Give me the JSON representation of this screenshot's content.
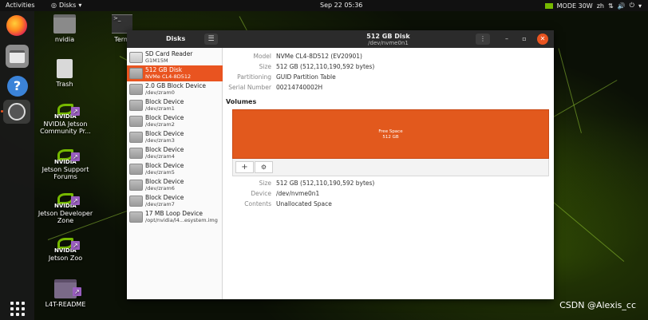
{
  "topbar": {
    "activities": "Activities",
    "app_menu": "Disks",
    "app_menu_arrow": "▾",
    "clock": "Sep 22  05:36",
    "power_mode": "MODE 30W",
    "lang": "zh",
    "menu_arrow": "▾"
  },
  "desktop": {
    "icons": [
      {
        "label": "nvidia"
      },
      {
        "label": "Term"
      },
      {
        "label": "Trash"
      },
      {
        "label": "NVIDIA Jetson Community Pr..."
      },
      {
        "label": "Jetson Support Forums"
      },
      {
        "label": "Jetson Developer Zone"
      },
      {
        "label": "Jetson Zoo"
      },
      {
        "label": "L4T-README"
      }
    ],
    "watermark": "CSDN @Alexis_cc",
    "term_prompt": ">_"
  },
  "window": {
    "sidebar_title": "Disks",
    "menu_glyph": "☰",
    "title": "512 GB Disk",
    "subtitle": "/dev/nvme0n1",
    "options_glyph": "⋮",
    "min_glyph": "–",
    "max_glyph": "▫",
    "close_glyph": "✕"
  },
  "devices": [
    {
      "name": "SD Card Reader",
      "sub": "G1M15M"
    },
    {
      "name": "512 GB Disk",
      "sub": "NVMe CL4-8D512"
    },
    {
      "name": "2.0 GB Block Device",
      "sub": "/dev/zram0"
    },
    {
      "name": "Block Device",
      "sub": "/dev/zram1"
    },
    {
      "name": "Block Device",
      "sub": "/dev/zram2"
    },
    {
      "name": "Block Device",
      "sub": "/dev/zram3"
    },
    {
      "name": "Block Device",
      "sub": "/dev/zram4"
    },
    {
      "name": "Block Device",
      "sub": "/dev/zram5"
    },
    {
      "name": "Block Device",
      "sub": "/dev/zram6"
    },
    {
      "name": "Block Device",
      "sub": "/dev/zram7"
    },
    {
      "name": "17 MB Loop Device",
      "sub": "/opt/nvidia/l4...esystem.img"
    }
  ],
  "disk_info": {
    "model_label": "Model",
    "model": "NVMe CL4-8D512 (EV20901)",
    "size_label": "Size",
    "size": "512 GB (512,110,190,592 bytes)",
    "partitioning_label": "Partitioning",
    "partitioning": "GUID Partition Table",
    "serial_label": "Serial Number",
    "serial": "00214740002H"
  },
  "volumes": {
    "heading": "Volumes",
    "segment_title": "Free Space",
    "segment_size": "512 GB",
    "add_glyph": "+",
    "settings_glyph": "⚙"
  },
  "volume_info": {
    "size_label": "Size",
    "size": "512 GB (512,110,190,592 bytes)",
    "device_label": "Device",
    "device": "/dev/nvme0n1",
    "contents_label": "Contents",
    "contents": "Unallocated Space"
  },
  "colors": {
    "accent": "#e95420",
    "nvidia": "#76b900"
  }
}
